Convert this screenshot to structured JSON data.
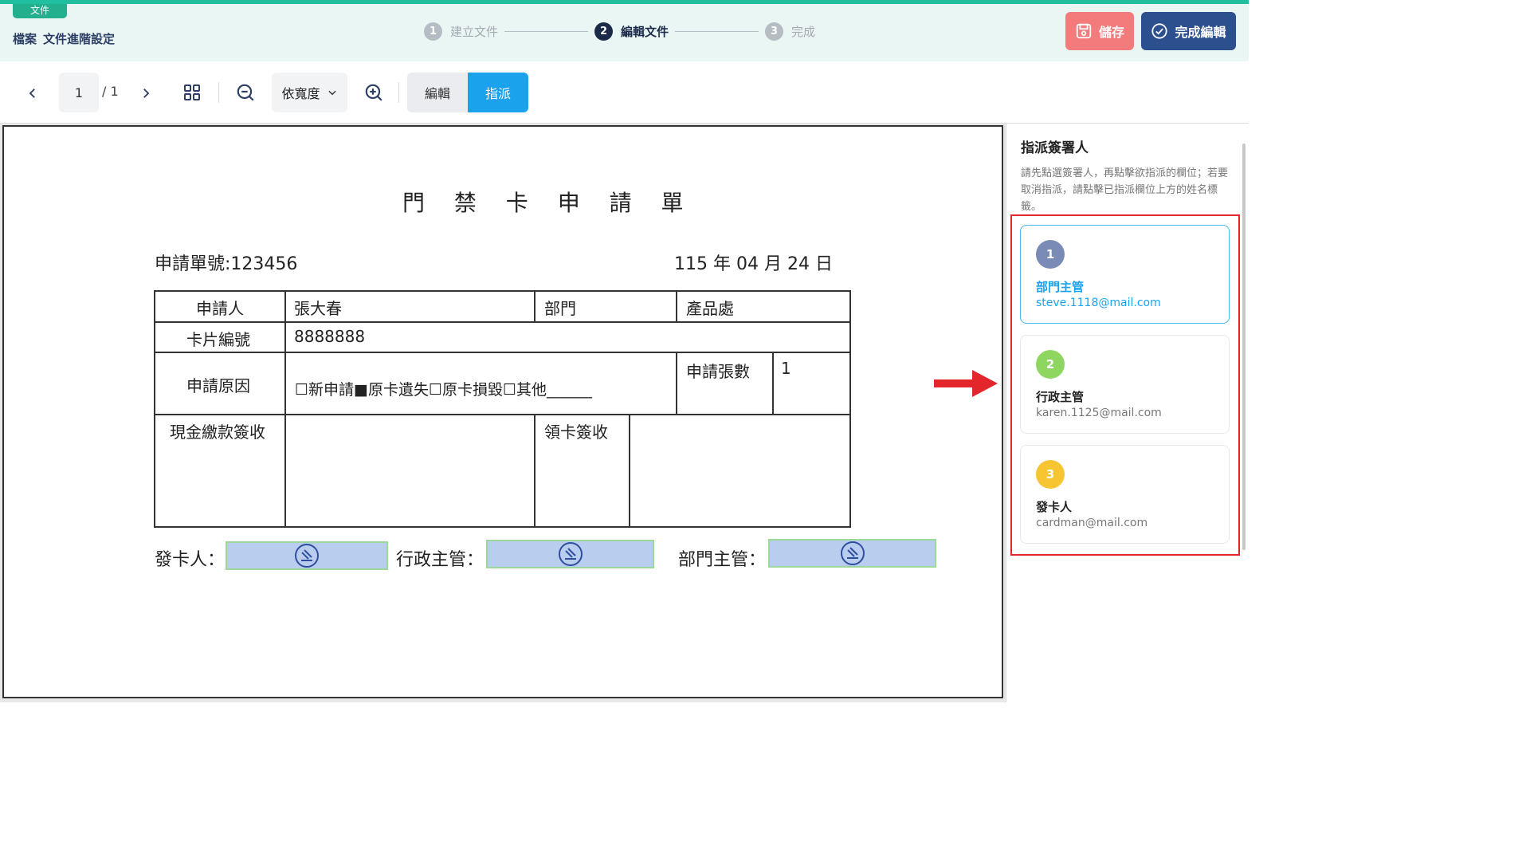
{
  "header": {
    "doc_tag": "文件",
    "breadcrumb": [
      "檔案",
      "文件進階設定"
    ],
    "steps": [
      {
        "num": "1",
        "label": "建立文件"
      },
      {
        "num": "2",
        "label": "編輯文件"
      },
      {
        "num": "3",
        "label": "完成"
      }
    ],
    "save_label": "儲存",
    "done_label": "完成編輯"
  },
  "toolbar": {
    "current_page": "1",
    "total_pages": "/ 1",
    "zoom_mode": "依寬度",
    "mode_edit": "編輯",
    "mode_assign": "指派"
  },
  "document": {
    "title": "門 禁 卡 申 請 單",
    "form_no": "申請單號:123456",
    "date": "115 年 04 月 24 日",
    "table": {
      "applicant_label": "申請人",
      "applicant_value": "張大春",
      "dept_label": "部門",
      "dept_value": "產品處",
      "card_no_label": "卡片編號",
      "card_no_value": "8888888",
      "reason_label": "申請原因",
      "reason_value": "☐新申請■原卡遺失☐原卡損毀☐其他______",
      "count_label": "申請張數",
      "count_value": "1",
      "cash_label": "現金繳款簽收",
      "receive_label": "領卡簽收"
    },
    "signatures": {
      "issuer_label": "發卡人：",
      "admin_label": "行政主管：",
      "dept_head_label": "部門主管："
    }
  },
  "panel": {
    "title": "指派簽署人",
    "description": "請先點選簽署人，再點擊欲指派的欄位；若要取消指派，請點擊已指派欄位上方的姓名標籤。",
    "signers": [
      {
        "num": "1",
        "role": "部門主管",
        "email": "steve.1118@mail.com",
        "color": "#7a8cb5"
      },
      {
        "num": "2",
        "role": "行政主管",
        "email": "karen.1125@mail.com",
        "color": "#8ed660"
      },
      {
        "num": "3",
        "role": "發卡人",
        "email": "cardman@mail.com",
        "color": "#f7c531"
      }
    ]
  },
  "colors": {
    "accent": "#1aa3ec",
    "save": "#f47b7b",
    "done": "#2c4f8e",
    "highlight": "#e3262b"
  }
}
